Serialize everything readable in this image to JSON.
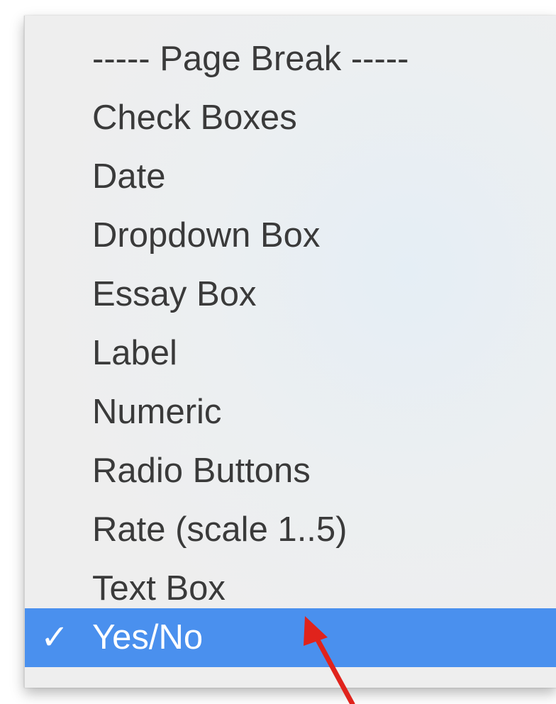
{
  "menu": {
    "items": [
      {
        "label": "----- Page Break -----",
        "selected": false
      },
      {
        "label": "Check Boxes",
        "selected": false
      },
      {
        "label": "Date",
        "selected": false
      },
      {
        "label": "Dropdown Box",
        "selected": false
      },
      {
        "label": "Essay Box",
        "selected": false
      },
      {
        "label": "Label",
        "selected": false
      },
      {
        "label": "Numeric",
        "selected": false
      },
      {
        "label": "Radio Buttons",
        "selected": false
      },
      {
        "label": "Rate (scale 1..5)",
        "selected": false
      },
      {
        "label": "Text Box",
        "selected": false
      },
      {
        "label": "Yes/No",
        "selected": true
      }
    ],
    "check_mark": "✓",
    "selection_color": "#4a90ee"
  },
  "annotation": {
    "arrow_color": "#e0231c",
    "points_to": "Yes/No"
  }
}
